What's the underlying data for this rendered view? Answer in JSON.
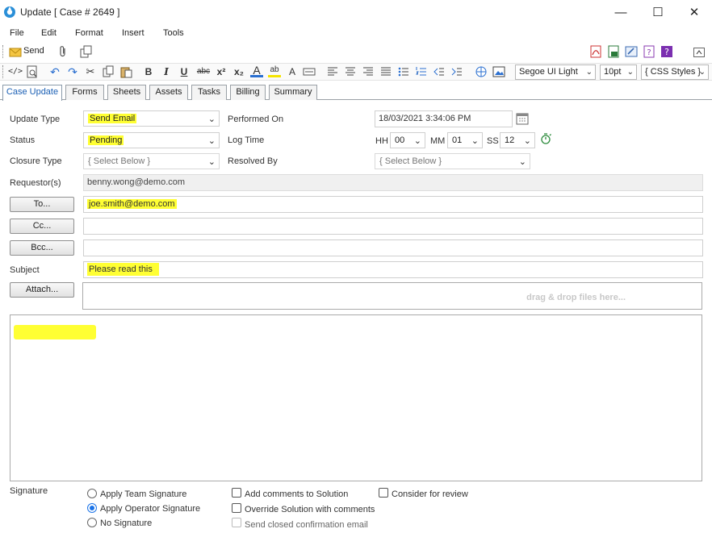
{
  "window": {
    "title": "Update [ Case # 2649 ]",
    "minimize": "—",
    "maximize": "☐",
    "close": "✕"
  },
  "menu": [
    "File",
    "Edit",
    "Format",
    "Insert",
    "Tools"
  ],
  "toolbar": {
    "send_label": "Send",
    "font_family": "Segoe UI Light",
    "font_size": "10pt",
    "css_styles": "{ CSS Styles }"
  },
  "tabs": [
    "Case Update",
    "Forms",
    "Sheets",
    "Assets",
    "Tasks",
    "Billing",
    "Summary"
  ],
  "form": {
    "update_type_label": "Update Type",
    "update_type_value": "Send Email",
    "status_label": "Status",
    "status_value": "Pending",
    "closure_type_label": "Closure Type",
    "closure_type_value": "{ Select Below }",
    "requestors_label": "Requestor(s)",
    "requestors_value": "benny.wong@demo.com",
    "performed_on_label": "Performed On",
    "performed_on_value": "18/03/2021 3:34:06 PM",
    "log_time_label": "Log Time",
    "hh_label": "HH",
    "hh_value": "00",
    "mm_label": "MM",
    "mm_value": "01",
    "ss_label": "SS",
    "ss_value": "12",
    "resolved_by_label": "Resolved By",
    "resolved_by_value": "{ Select Below }",
    "to_button": "To...",
    "to_value": "joe.smith@demo.com",
    "cc_button": "Cc...",
    "cc_value": "",
    "bcc_button": "Bcc...",
    "bcc_value": "",
    "subject_label": "Subject",
    "subject_value": "Please read this",
    "attach_button": "Attach...",
    "dropzone_text": "drag & drop files here..."
  },
  "signature": {
    "label": "Signature",
    "options": [
      "Apply Team Signature",
      "Apply Operator Signature",
      "No Signature"
    ],
    "selected_index": 1
  },
  "checkboxes": {
    "add_comments": "Add comments to Solution",
    "override_solution": "Override Solution with comments",
    "send_closed": "Send closed confirmation email",
    "consider_review": "Consider for review"
  },
  "colors": {
    "highlight": "#ffff33",
    "accent": "#1a5fb4"
  }
}
